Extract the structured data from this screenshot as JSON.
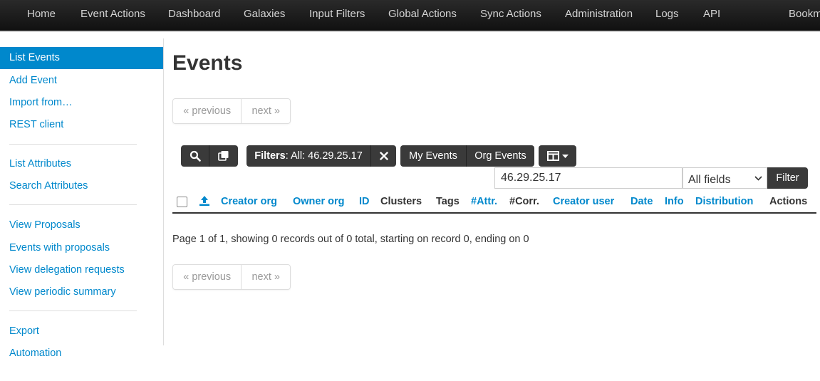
{
  "nav": {
    "items": [
      "Home",
      "Event Actions",
      "Dashboard",
      "Galaxies",
      "Input Filters",
      "Global Actions",
      "Sync Actions",
      "Administration",
      "Logs",
      "API",
      "Bookm"
    ]
  },
  "sidebar": {
    "items": [
      "List Events",
      "Add Event",
      "Import from…",
      "REST client",
      "List Attributes",
      "Search Attributes",
      "View Proposals",
      "Events with proposals",
      "View delegation requests",
      "View periodic summary",
      "Export",
      "Automation"
    ],
    "active": "List Events"
  },
  "main": {
    "title": "Events",
    "pager": {
      "previous": "« previous",
      "next": "next »"
    },
    "toolbar": {
      "filters_label": "Filters",
      "filters_value": ": All: 46.29.25.17",
      "my_events": "My Events",
      "org_events": "Org Events"
    },
    "search": {
      "value": "46.29.25.17",
      "field_selected": "All fields",
      "filter_button": "Filter"
    },
    "columns": [
      "Creator org",
      "Owner org",
      "ID",
      "Clusters",
      "Tags",
      "#Attr.",
      "#Corr.",
      "Creator user",
      "Date",
      "Info",
      "Distribution",
      "Actions"
    ],
    "summary": "Page 1 of 1, showing 0 records out of 0 total, starting on record 0, ending on 0"
  },
  "colors": {
    "accent": "#0088cc",
    "navbar": "#1f1f1f",
    "button": "#3a3a3a"
  }
}
